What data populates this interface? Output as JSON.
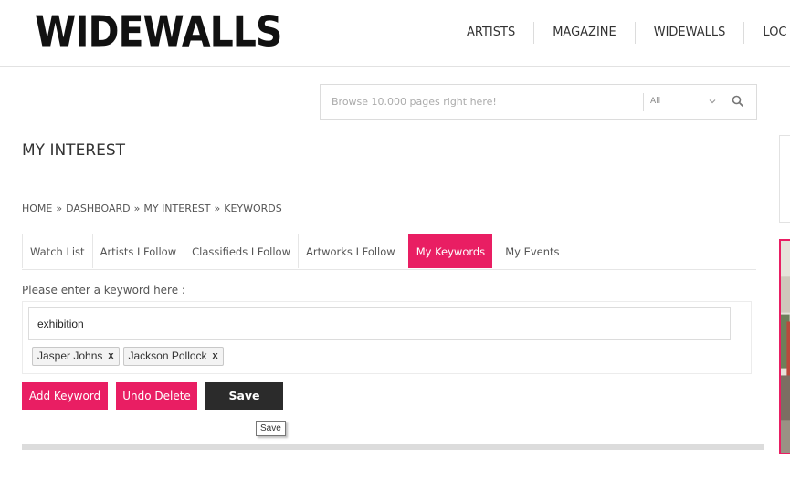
{
  "brand": {
    "logo_text": "WIDEWALLS"
  },
  "nav": {
    "items": [
      "ARTISTS",
      "MAGAZINE",
      "WIDEWALLS",
      "LOC"
    ]
  },
  "search": {
    "placeholder": "Browse 10.000 pages right here!",
    "scope": "All",
    "icon": "search-icon"
  },
  "page": {
    "title": "MY INTEREST"
  },
  "breadcrumb": {
    "items": [
      "HOME",
      "DASHBOARD",
      "MY INTEREST",
      "KEYWORDS"
    ],
    "separator": "»"
  },
  "tabs": {
    "items": [
      "Watch List",
      "Artists I Follow",
      "Classifieds I Follow",
      "Artworks I Follow",
      "My Keywords",
      "My Events"
    ],
    "active": "My Keywords"
  },
  "keywords": {
    "prompt": "Please enter a keyword here :",
    "input_value": "exhibition",
    "tags": [
      {
        "label": "Jasper Johns",
        "remove": "x"
      },
      {
        "label": "Jackson Pollock",
        "remove": "x"
      }
    ]
  },
  "actions": {
    "add_label": "Add Keyword",
    "undo_label": "Undo Delete",
    "save_label": "Save",
    "tooltip": "Save"
  },
  "colors": {
    "accent": "#e91e63",
    "dark_button": "#2b2b2b"
  }
}
